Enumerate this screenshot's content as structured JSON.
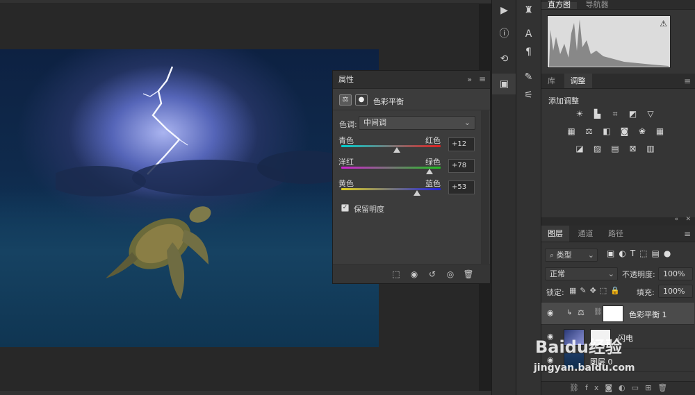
{
  "properties_panel": {
    "title": "属性",
    "collapse_icon": "double-chevron-icon",
    "menu_icon": "menu-icon",
    "adjustment_name": "色彩平衡",
    "tone_label": "色调:",
    "tone_value": "中间调",
    "sliders": [
      {
        "left": "青色",
        "right": "红色",
        "value": "+12",
        "level": 12,
        "colors": [
          "#00d0d0",
          "#e02020"
        ]
      },
      {
        "left": "洋红",
        "right": "绿色",
        "value": "+78",
        "level": 78,
        "colors": [
          "#d020d0",
          "#20c020"
        ]
      },
      {
        "left": "黄色",
        "right": "蓝色",
        "value": "+53",
        "level": 53,
        "colors": [
          "#e0d020",
          "#2020e0"
        ]
      }
    ],
    "preserve_luminosity_label": "保留明度",
    "preserve_luminosity_checked": true
  },
  "tool_column_1": {
    "icons": [
      "play-icon",
      "info-icon",
      "history-icon",
      "properties-icon"
    ]
  },
  "tool_column_2": {
    "icons": [
      "stamp-icon",
      "character-icon",
      "paragraph-icon",
      "brush-icon",
      "adjust-icon"
    ]
  },
  "histogram_panel": {
    "tabs": [
      "直方图",
      "导航器"
    ],
    "warning_icon": "warning-icon"
  },
  "adjustments_panel": {
    "tabs": [
      "库",
      "调整"
    ],
    "active_tab": "调整",
    "heading": "添加调整"
  },
  "layers_panel": {
    "tabs": [
      "图层",
      "通道",
      "路径"
    ],
    "active_tab": "图层",
    "filter_label": "类型",
    "blend_mode": "正常",
    "opacity_label": "不透明度:",
    "opacity_value": "100%",
    "lock_label": "锁定:",
    "fill_label": "填充:",
    "fill_value": "100%",
    "layers": [
      {
        "name": "色彩平衡 1",
        "selected": true
      },
      {
        "name": "闪电",
        "selected": false
      },
      {
        "name": "图层 0",
        "selected": false
      }
    ],
    "footer_icons": [
      "link-icon",
      "fx-icon",
      "mask-icon",
      "adjustment-icon",
      "folder-icon",
      "new-layer-icon",
      "trash-icon"
    ]
  },
  "watermark": {
    "brand": "Baidu经验",
    "url": "jingyan.baidu.com"
  }
}
